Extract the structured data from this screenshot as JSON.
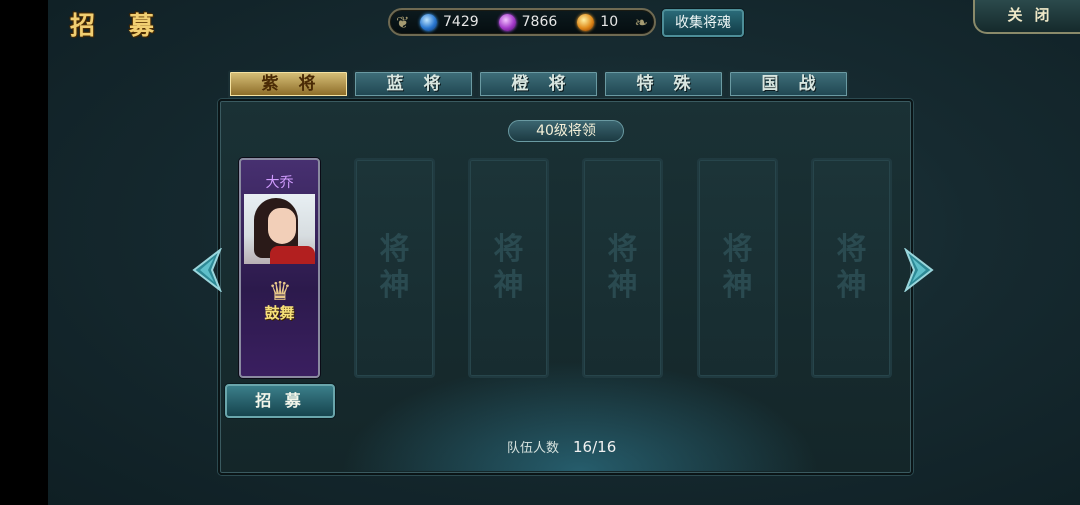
{
  "header": {
    "title_chars": [
      "招",
      "募"
    ],
    "close_label": "关闭"
  },
  "resources": [
    {
      "icon": "blue-orb-icon",
      "value": "7429"
    },
    {
      "icon": "purple-orb-icon",
      "value": "7866"
    },
    {
      "icon": "gold-orb-icon",
      "value": "10"
    }
  ],
  "collect_button": "收集将魂",
  "tabs": [
    {
      "label": "紫将",
      "active": true
    },
    {
      "label": "蓝将",
      "active": false
    },
    {
      "label": "橙将",
      "active": false
    },
    {
      "label": "特殊",
      "active": false
    },
    {
      "label": "国战",
      "active": false
    }
  ],
  "panel": {
    "level_label": "40级将领",
    "hero": {
      "name": "大乔",
      "skill": "鼓舞"
    },
    "empty_slot_watermark": [
      "将",
      "神"
    ],
    "recruit_button": "招 募",
    "team_label": "队伍人数",
    "team_value": "16/16"
  },
  "colors": {
    "accent_gold": "#f1cf72",
    "hero_purple": "#d19cff",
    "skill_yellow": "#f6e07a",
    "teal_button": "#3b7f8a"
  }
}
